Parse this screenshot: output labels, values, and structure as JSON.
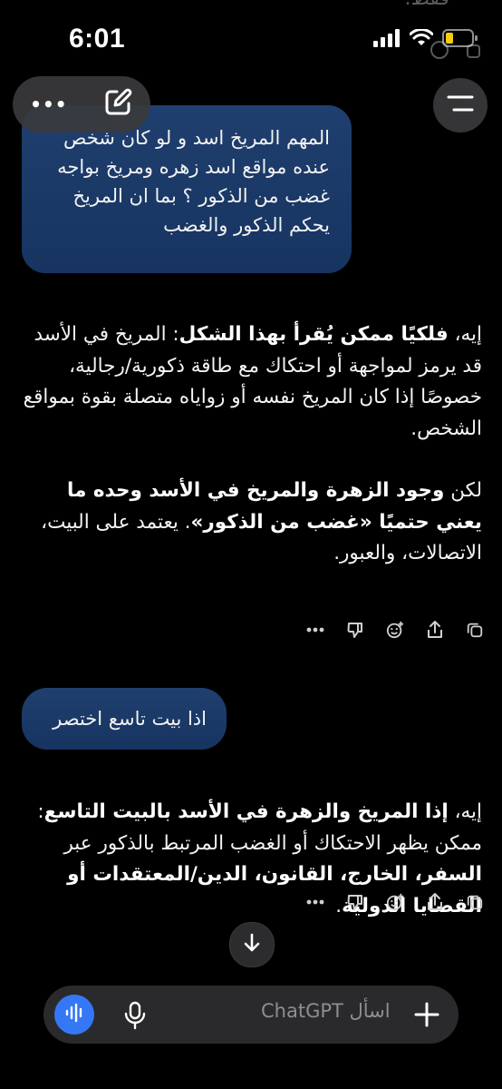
{
  "status_bar": {
    "time": "6:01"
  },
  "top_fragment": "فقط.",
  "header": {
    "more_label": "•••"
  },
  "messages": {
    "user_1_lines": [
      "المهم المريخ اسد و لو كان شخص",
      "عنده مواقع اسد زهره ومريخ  بواجه",
      "غضب من الذكور ؟ بما ان المريخ",
      "يحكم الذكور والغضب"
    ],
    "answer_1": {
      "p1_intro": "إيه، ",
      "p1_bold": "فلكيًا ممكن يُقرأ بهذا الشكل",
      "p1_rest": ": المريخ في الأسد قد يرمز لمواجهة أو احتكاك مع طاقة ذكورية/رجالية، خصوصًا إذا كان المريخ نفسه أو زواياه متصلة بقوة بمواقع الشخص.",
      "p2_a": "لكن ",
      "p2_bold": "وجود الزهرة والمريخ في الأسد وحده ما يعني حتميًا «غضب من الذكور»",
      "p2_rest": ". يعتمد على البيت، الاتصالات، والعبور."
    },
    "user_2": "اذا بيت تاسع اختصر",
    "answer_2": {
      "intro": "إيه، ",
      "bold_1": "إذا المريخ والزهرة في الأسد بالبيت التاسع",
      "rest_1": ": ممكن يظهر الاحتكاك أو الغضب المرتبط بالذكور عبر ",
      "bold_2": "السفر، الخارج، القانون، الدين/المعتقدات أو القضايا الدولية",
      "end": "."
    }
  },
  "composer": {
    "placeholder": "اسأل ChatGPT"
  },
  "colors": {
    "bubble": "#1f3f6e",
    "accent": "#3478f6",
    "composer_bg": "#2a2a2c"
  }
}
